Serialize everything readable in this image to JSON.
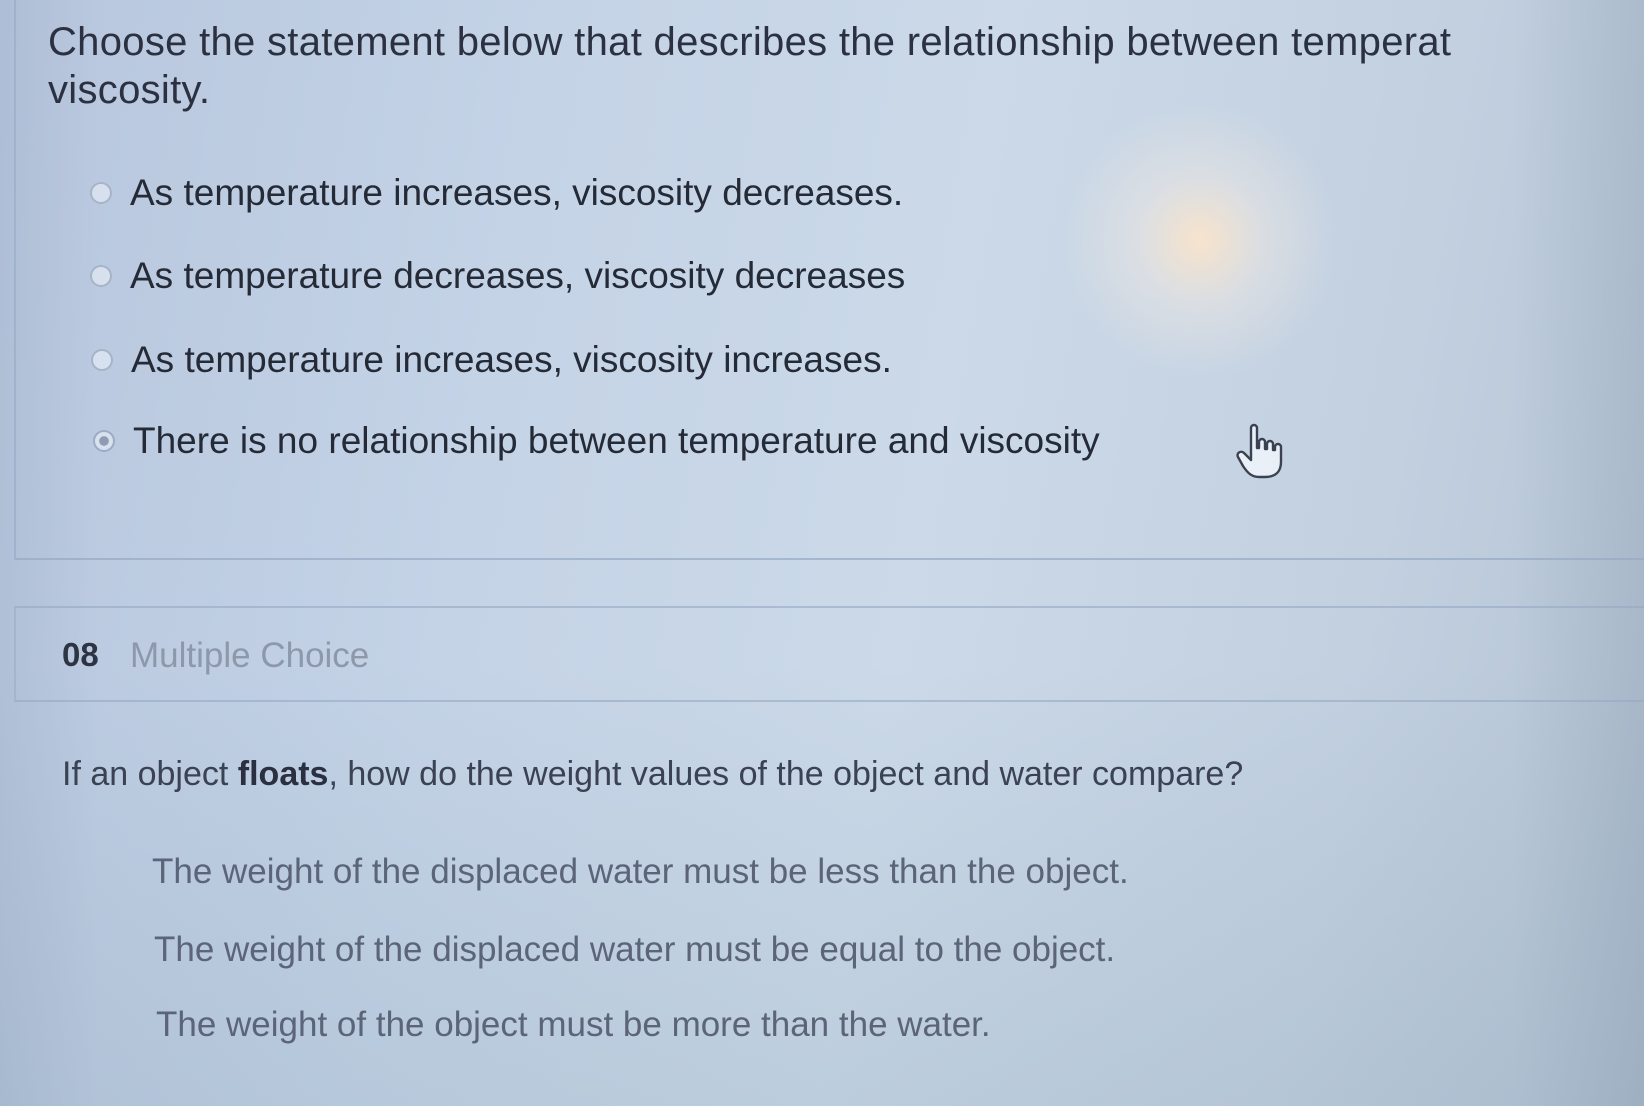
{
  "question7": {
    "prompt_line1": "Choose the statement below that describes the relationship between temperat",
    "prompt_line2": "viscosity.",
    "options": [
      {
        "label": "As temperature increases, viscosity decreases.",
        "selected": false
      },
      {
        "label": "As temperature decreases, viscosity decreases",
        "selected": false
      },
      {
        "label": "As temperature increases, viscosity increases.",
        "selected": false
      },
      {
        "label": "There is no relationship between temperature and viscosity",
        "selected": true
      }
    ]
  },
  "question8": {
    "number": "08",
    "type": "Multiple Choice",
    "prompt_before": "If an object ",
    "prompt_bold": "floats",
    "prompt_after": ", how do the weight values of the object and water compare?",
    "options": [
      {
        "label": "The weight of the displaced water must be less than the object."
      },
      {
        "label": "The weight of the displaced water must be equal to the object."
      },
      {
        "label": "The weight of the object must be more than the water."
      }
    ]
  },
  "colors": {
    "background": "#c4d3e6",
    "text_dark": "#252a37",
    "text_muted": "#8d98ab",
    "selected_radio": "#8e9bb3"
  },
  "icons": {
    "cursor": "hand-pointer-icon"
  }
}
